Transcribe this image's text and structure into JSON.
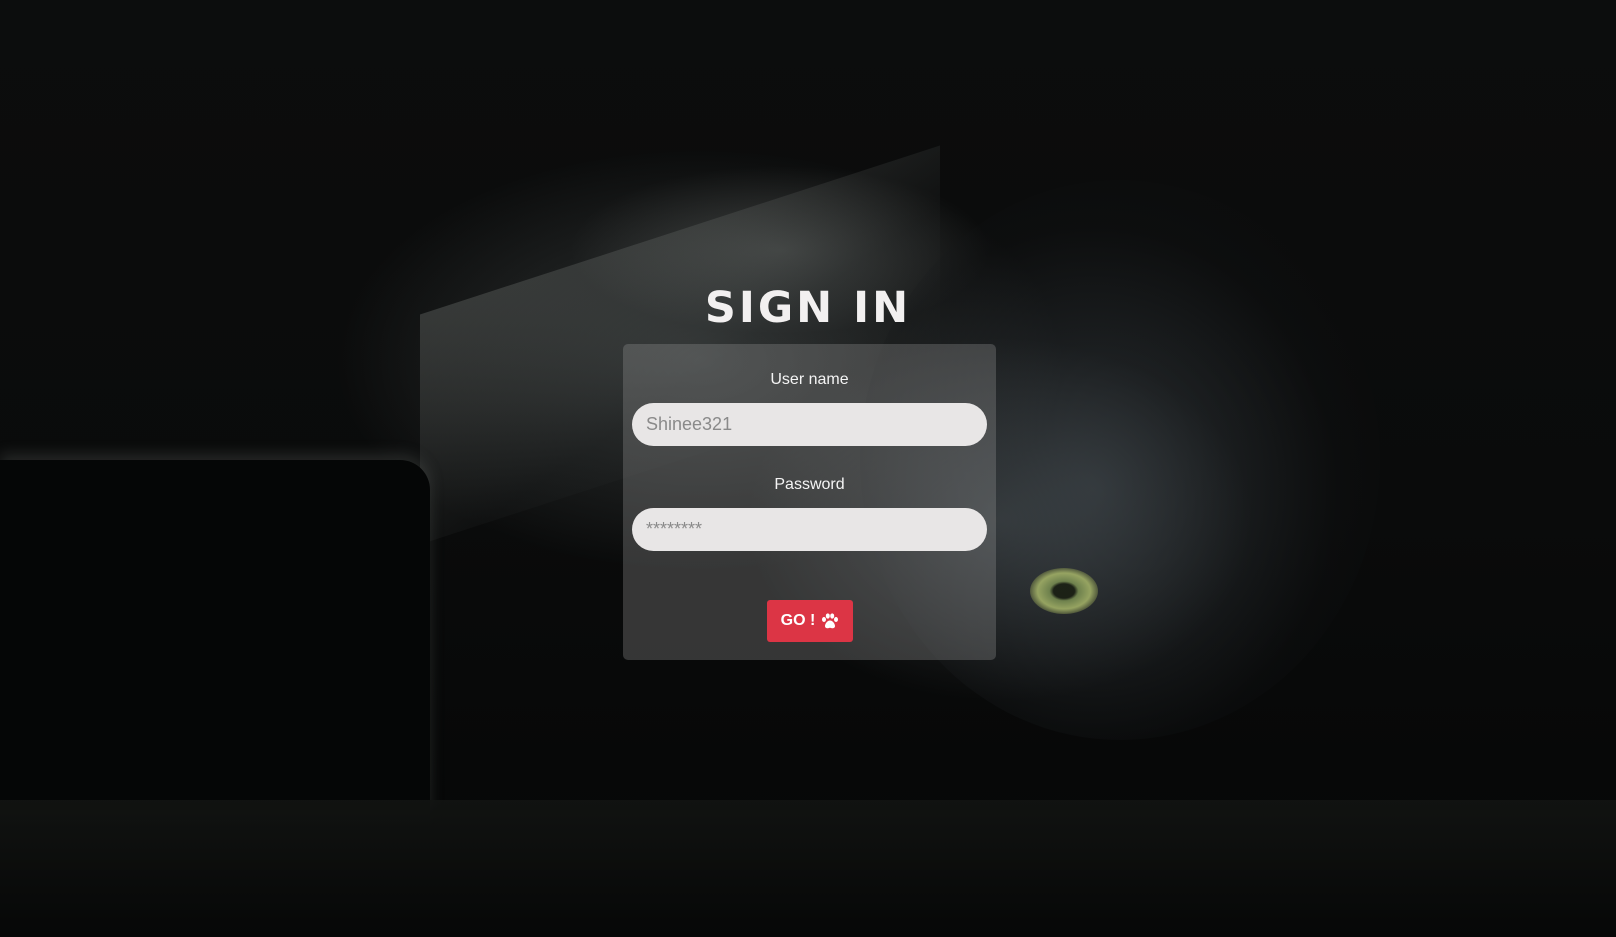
{
  "page": {
    "title": "SIGN IN"
  },
  "form": {
    "username_label": "User name",
    "username_placeholder": "Shinee321",
    "password_label": "Password",
    "password_placeholder": "********",
    "submit_label": "GO !",
    "submit_icon": "paw-icon"
  },
  "colors": {
    "accent": "#dc3545",
    "title": "#f2f0f0",
    "input_bg": "#e8e6e6"
  },
  "background": {
    "description_icon": "cat-photo-background"
  }
}
